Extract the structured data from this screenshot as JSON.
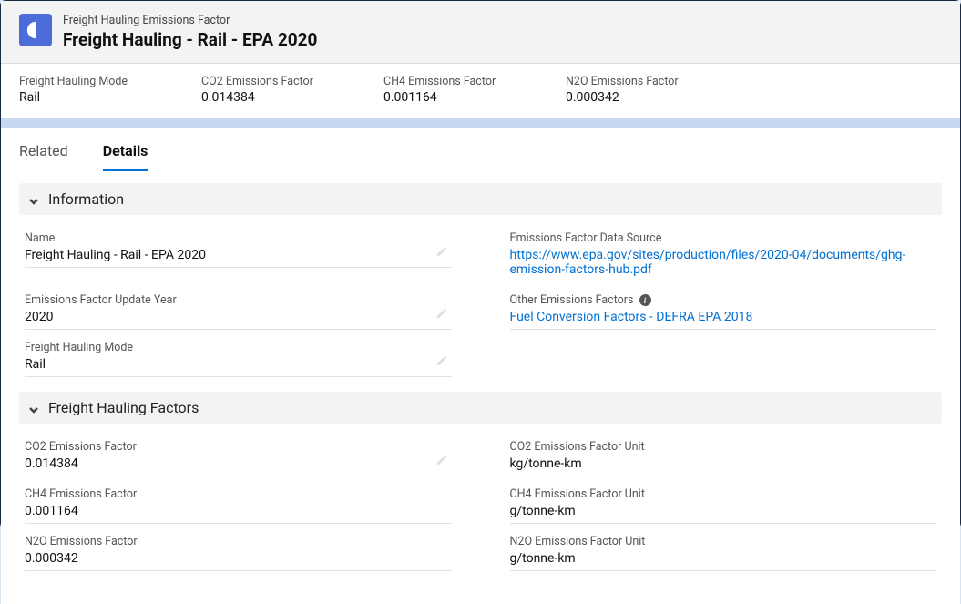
{
  "header": {
    "object_label": "Freight Hauling Emissions Factor",
    "title": "Freight Hauling - Rail - EPA 2020"
  },
  "summary": [
    {
      "label": "Freight Hauling Mode",
      "value": "Rail"
    },
    {
      "label": "CO2 Emissions Factor",
      "value": "0.014384"
    },
    {
      "label": "CH4 Emissions Factor",
      "value": "0.001164"
    },
    {
      "label": "N2O Emissions Factor",
      "value": "0.000342"
    }
  ],
  "tabs": {
    "related": "Related",
    "details": "Details"
  },
  "sections": {
    "information": {
      "title": "Information",
      "name_label": "Name",
      "name_value": "Freight Hauling - Rail - EPA 2020",
      "data_source_label": "Emissions Factor Data Source",
      "data_source_value": "https://www.epa.gov/sites/production/files/2020-04/documents/ghg-emission-factors-hub.pdf",
      "update_year_label": "Emissions Factor Update Year",
      "update_year_value": "2020",
      "other_factors_label": "Other Emissions Factors",
      "other_factors_value": "Fuel Conversion Factors - DEFRA EPA 2018",
      "mode_label": "Freight Hauling Mode",
      "mode_value": "Rail"
    },
    "factors": {
      "title": "Freight Hauling Factors",
      "co2_label": "CO2 Emissions Factor",
      "co2_value": "0.014384",
      "co2_unit_label": "CO2 Emissions Factor Unit",
      "co2_unit_value": "kg/tonne-km",
      "ch4_label": "CH4 Emissions Factor",
      "ch4_value": "0.001164",
      "ch4_unit_label": "CH4 Emissions Factor Unit",
      "ch4_unit_value": "g/tonne-km",
      "n2o_label": "N2O Emissions Factor",
      "n2o_value": "0.000342",
      "n2o_unit_label": "N2O Emissions Factor Unit",
      "n2o_unit_value": "g/tonne-km"
    }
  }
}
